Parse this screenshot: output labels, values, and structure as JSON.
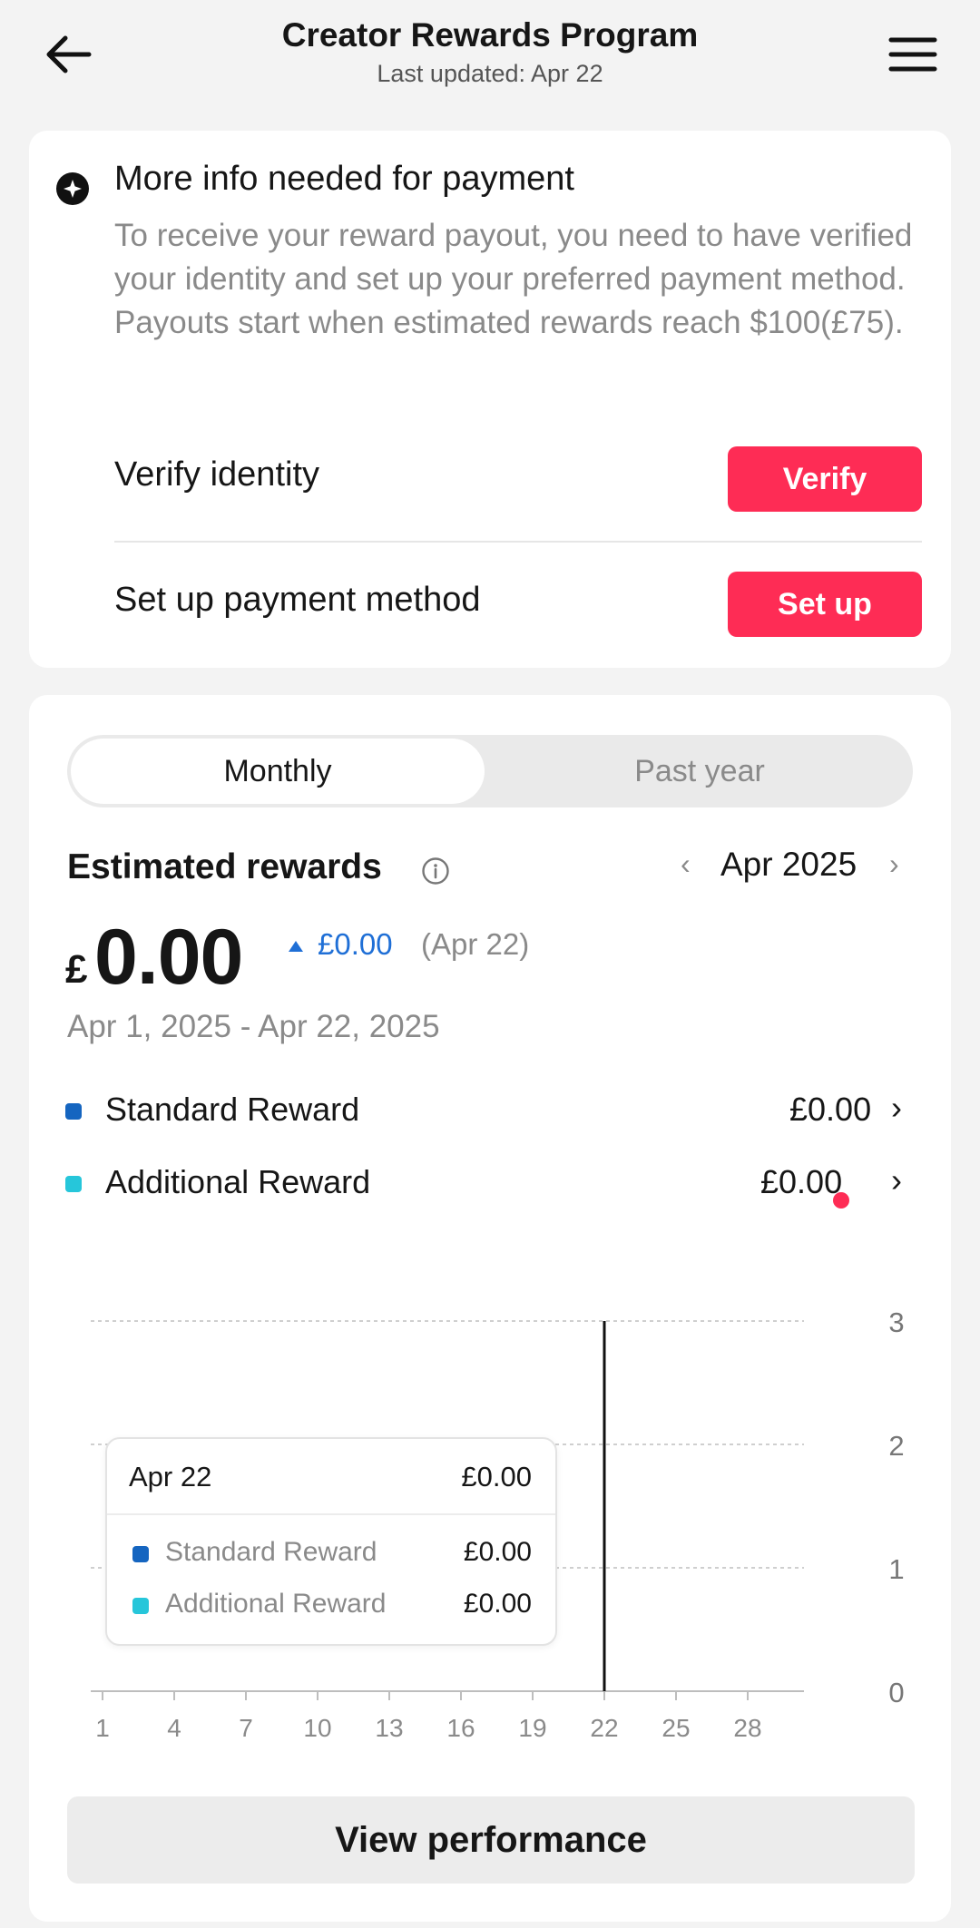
{
  "header": {
    "title": "Creator Rewards Program",
    "subtitle": "Last updated: Apr 22"
  },
  "notice": {
    "title": "More info needed for payment",
    "body": "To receive your reward payout, you need to have verified your identity and set up your preferred payment method. Payouts start when estimated rewards reach $100(£75).",
    "rows": [
      {
        "label": "Verify identity",
        "button": "Verify"
      },
      {
        "label": "Set up payment method",
        "button": "Set up"
      }
    ]
  },
  "tabs": {
    "active": "Monthly",
    "inactive": "Past year"
  },
  "rewards": {
    "title": "Estimated rewards",
    "month_prev": "‹",
    "month": "Apr 2025",
    "month_next": "›",
    "currency_symbol": "£",
    "amount": "0.00",
    "delta_amount": "£0.00",
    "delta_date": "(Apr 22)",
    "range": "Apr 1, 2025 - Apr 22, 2025",
    "legend": [
      {
        "label": "Standard Reward",
        "value": "£0.00",
        "color": "#1565c0"
      },
      {
        "label": "Additional Reward",
        "value": "£0.00",
        "color": "#26c6da"
      }
    ],
    "chevron": "›"
  },
  "chart_data": {
    "type": "bar",
    "x": [
      "1",
      "4",
      "7",
      "10",
      "13",
      "16",
      "19",
      "22",
      "25",
      "28"
    ],
    "y_ticks": [
      "0",
      "1",
      "2",
      "3"
    ],
    "ylim": [
      0,
      3
    ],
    "series": [
      {
        "name": "Standard Reward",
        "values": [
          0,
          0,
          0,
          0,
          0,
          0,
          0,
          0,
          0,
          0
        ]
      },
      {
        "name": "Additional Reward",
        "values": [
          0,
          0,
          0,
          0,
          0,
          0,
          0,
          0,
          0,
          0
        ]
      }
    ],
    "selected_x": "22",
    "grid": true
  },
  "tooltip": {
    "date": "Apr 22",
    "total": "£0.00",
    "rows": [
      {
        "label": "Standard Reward",
        "value": "£0.00"
      },
      {
        "label": "Additional Reward",
        "value": "£0.00"
      }
    ]
  },
  "actions": {
    "view_performance": "View performance"
  },
  "colors": {
    "accent_red": "#fe2c55",
    "delta_blue": "#1f6fd6",
    "standard": "#1565c0",
    "additional": "#26c6da"
  }
}
